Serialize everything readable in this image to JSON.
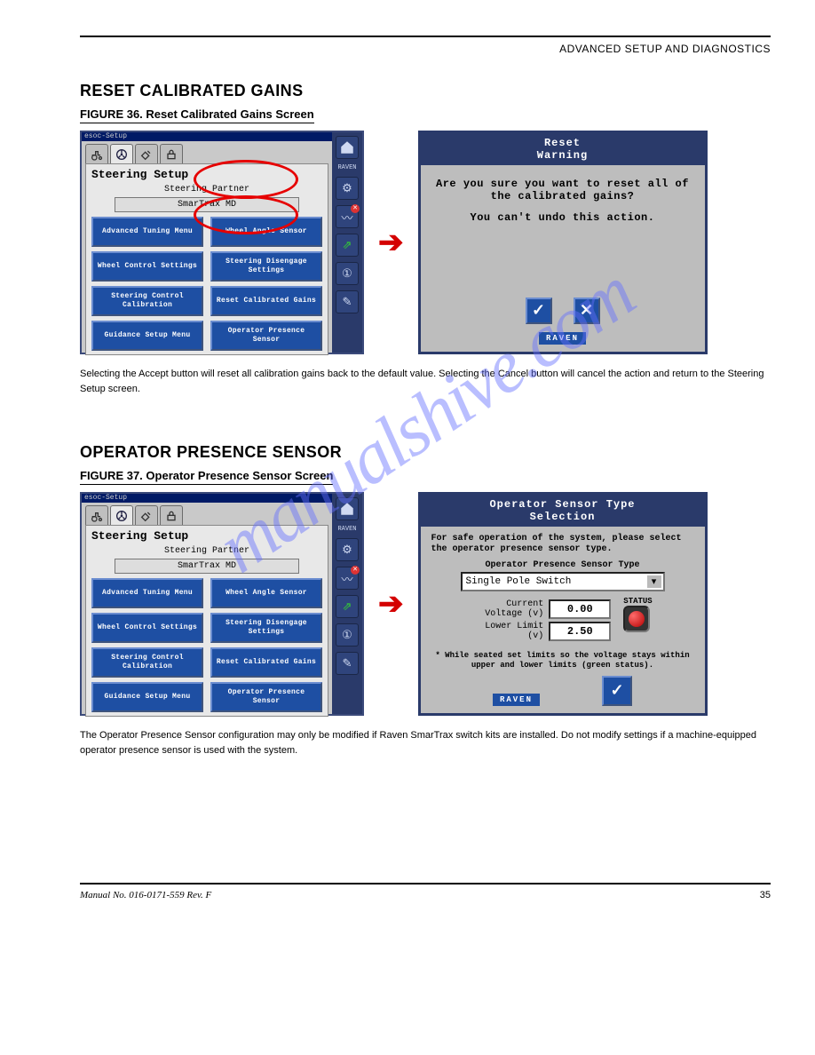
{
  "breadcrumb": "ADVANCED SETUP AND DIAGNOSTICS",
  "watermark": "manualshive.com",
  "sections": [
    {
      "title": "RESET CALIBRATED GAINS",
      "caption": "FIGURE 36. Reset Calibrated Gains Screen",
      "note": "Selecting the Accept button will reset all calibration gains back to the default value. Selecting the Cancel button will cancel the action and return to the Steering Setup screen."
    },
    {
      "title": "OPERATOR PRESENCE SENSOR",
      "caption": "FIGURE 37. Operator Presence Sensor Screen",
      "note": "The Operator Presence Sensor configuration may only be modified if Raven SmarTrax switch kits are installed. Do not modify settings if a machine-equipped operator presence sensor is used with the system."
    }
  ],
  "setup": {
    "titlebar": "esoc-Setup",
    "title": "Steering Setup",
    "subhead": "Steering Partner",
    "partner": "SmarTrax MD",
    "buttons": [
      "Advanced Tuning Menu",
      "Wheel Angle Sensor",
      "Wheel Control Settings",
      "Steering Disengage Settings",
      "Steering Control Calibration",
      "Reset Calibrated Gains",
      "Guidance Setup Menu",
      "Operator Presence Sensor"
    ],
    "brand": "RAVEN"
  },
  "dialogs": {
    "reset": {
      "title": "Reset\nWarning",
      "line1": "Are you sure you want to reset all of the calibrated gains?",
      "line2": "You can't undo this action.",
      "brand": "RAVEN"
    },
    "sensor": {
      "title": "Operator Sensor Type\nSelection",
      "intro": "For safe operation of the system, please select the operator presence sensor type.",
      "type_label": "Operator Presence Sensor Type",
      "type_value": "Single Pole Switch",
      "current_label": "Current Voltage (v)",
      "current_value": "0.00",
      "lower_label": "Lower Limit (v)",
      "lower_value": "2.50",
      "status_label": "STATUS",
      "hint": "* While seated set limits so the voltage stays within upper and lower limits (green status).",
      "brand": "RAVEN"
    }
  },
  "footer": {
    "left": "Manual No. 016-0171-559 Rev. F",
    "right": "35"
  }
}
